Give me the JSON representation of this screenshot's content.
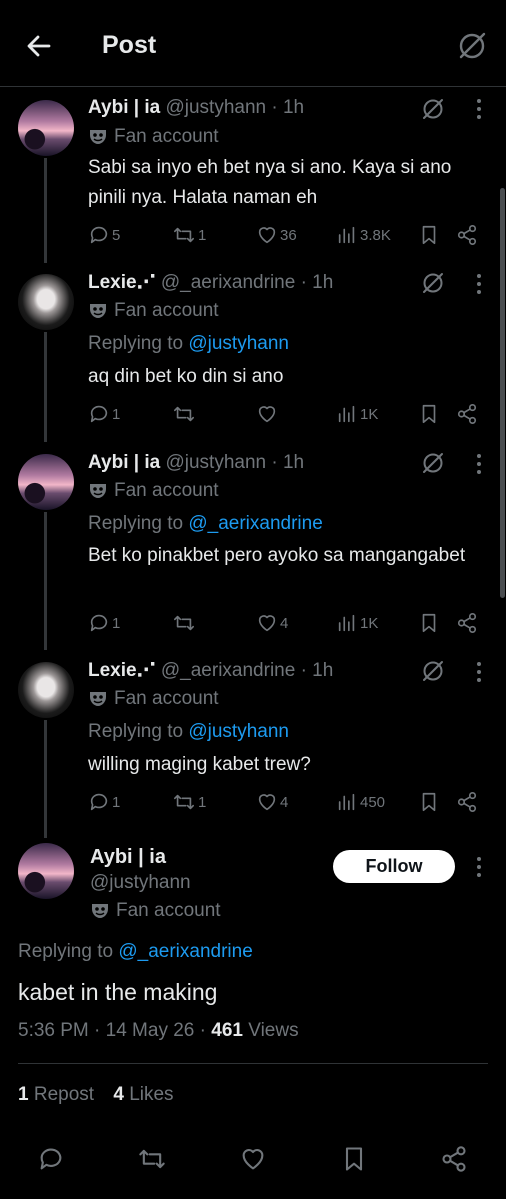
{
  "header": {
    "title": "Post"
  },
  "fan_label": "Fan account",
  "replying_to_label": "Replying to",
  "tweets": [
    {
      "name": "Aybi | ia",
      "handle": "@justyhann",
      "time": "· 1h",
      "text": "Sabi sa inyo eh bet nya si ano. Kaya si ano pinili nya. Halata naman eh",
      "replies": "5",
      "reposts": "1",
      "likes": "36",
      "views": "3.8K"
    },
    {
      "name": "Lexie⋰",
      "handle": "@_aerixandrine",
      "time": "· 1h",
      "reply_to": "@justyhann",
      "text": "aq din bet ko din si ano",
      "replies": "1",
      "reposts": "",
      "likes": "",
      "views": "1K"
    },
    {
      "name": "Aybi | ia",
      "handle": "@justyhann",
      "time": "· 1h",
      "reply_to": "@_aerixandrine",
      "text": "Bet ko pinakbet pero ayoko sa mangangabet",
      "replies": "1",
      "reposts": "",
      "likes": "4",
      "views": "1K"
    },
    {
      "name": "Lexie⋰",
      "handle": "@_aerixandrine",
      "time": "· 1h",
      "reply_to": "@justyhann",
      "text": "willing maging kabet trew?",
      "replies": "1",
      "reposts": "1",
      "likes": "4",
      "views": "450"
    }
  ],
  "main": {
    "name": "Aybi | ia",
    "handle": "@justyhann",
    "follow_label": "Follow",
    "reply_to": "@_aerixandrine",
    "text": "kabet in the making",
    "datetime": "5:36 PM · 14 May 26 ·",
    "views_count": "461",
    "views_label": "Views",
    "reposts_count": "1",
    "reposts_label": "Repost",
    "likes_count": "4",
    "likes_label": "Likes"
  }
}
